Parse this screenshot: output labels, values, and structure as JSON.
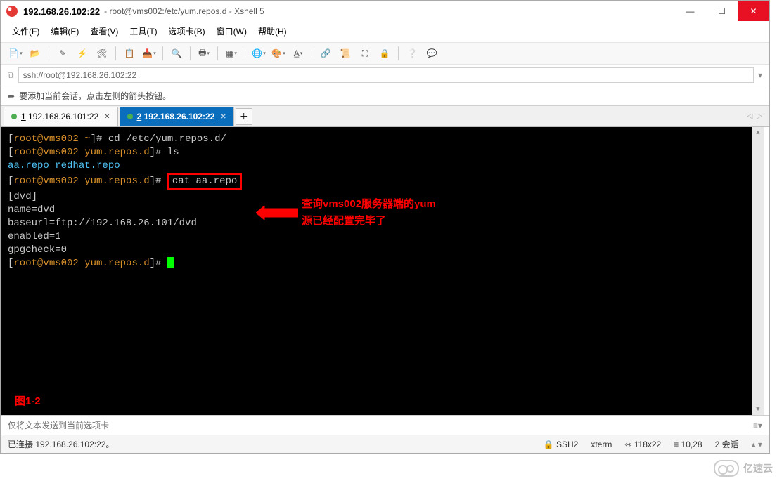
{
  "window": {
    "title_main": "192.168.26.102:22",
    "title_sub": "root@vms002:/etc/yum.repos.d - Xshell 5"
  },
  "menu": {
    "file": "文件(F)",
    "edit": "编辑(E)",
    "view": "查看(V)",
    "tools": "工具(T)",
    "tabs": "选项卡(B)",
    "window": "窗口(W)",
    "help": "帮助(H)"
  },
  "address": {
    "scheme_icon": "⧉",
    "url": "ssh://root@192.168.26.102:22"
  },
  "hint": {
    "icon": "➦",
    "text": "要添加当前会话，点击左侧的箭头按钮。"
  },
  "tabs": {
    "t1": {
      "num": "1",
      "label": "192.168.26.101:22"
    },
    "t2": {
      "num": "2",
      "label": "192.168.26.102:22"
    }
  },
  "term": {
    "l1_prompt_open": "[",
    "l1_user": "root@vms002",
    "l1_sep": " ",
    "l1_tilde": "~",
    "l1_close": "]# ",
    "l1_cmd": "cd /etc/yum.repos.d/",
    "l2_prompt": "[",
    "l2_user": "root@vms002",
    "l2_path": "yum.repos.d",
    "l2_close": "]# ",
    "l2_cmd": "ls",
    "l3_aa": "aa.repo",
    "l3_sp": "  ",
    "l3_rh": "redhat.repo",
    "l4_prompt": "[",
    "l4_user": "root@vms002",
    "l4_path": "yum.repos.d",
    "l4_close": "]# ",
    "l4_cmd": "cat aa.repo",
    "l5": "[dvd]",
    "l6": "name=dvd",
    "l7": "baseurl=ftp://192.168.26.101/dvd",
    "l8": "enabled=1",
    "l9": "gpgcheck=0",
    "l10_prompt": "[",
    "l10_user": "root@vms002",
    "l10_path": "yum.repos.d",
    "l10_close": "]# "
  },
  "annotation": {
    "line1": "查询vms002服务器端的yum",
    "line2": "源已经配置完毕了",
    "figure_label": "图1-2"
  },
  "sendbar": {
    "placeholder": "仅将文本发送到当前选项卡"
  },
  "status": {
    "conn": "已连接 192.168.26.102:22。",
    "proto": "SSH2",
    "termtype": "xterm",
    "size": "118x22",
    "pos": "10,28",
    "sessions": "2 会话"
  },
  "watermark": "亿速云"
}
